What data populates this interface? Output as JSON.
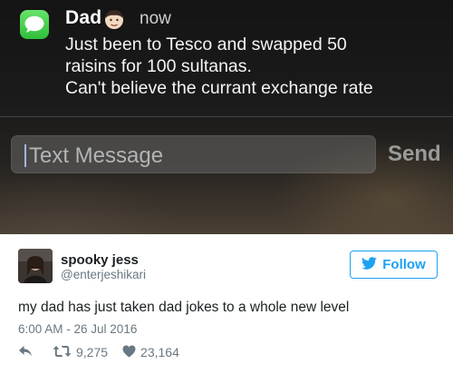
{
  "notification": {
    "app_icon": "messages-bubble-icon",
    "sender": "Dad",
    "sender_emoji": "man-face-emoji",
    "time": "now",
    "message_lines": [
      "Just been to Tesco and swapped 50",
      "raisins for 100 sultanas.",
      "Can't believe the currant exchange rate"
    ],
    "reply": {
      "placeholder": "Text Message",
      "send_label": "Send"
    },
    "colors": {
      "app_icon": "#2fbf3a",
      "background": "#1b1b1b"
    }
  },
  "tweet": {
    "display_name": "spooky jess",
    "handle": "@enterjeshikari",
    "follow_label": "Follow",
    "text": "my dad has just taken dad jokes to a whole new level",
    "timestamp": "6:00 AM - 26 Jul 2016",
    "retweets": "9,275",
    "likes": "23,164",
    "icons": [
      "twitter-bird-icon",
      "reply-icon",
      "retweet-icon",
      "heart-icon"
    ],
    "colors": {
      "accent": "#1da1f2",
      "text": "#1c2022",
      "muted": "#697882"
    }
  }
}
